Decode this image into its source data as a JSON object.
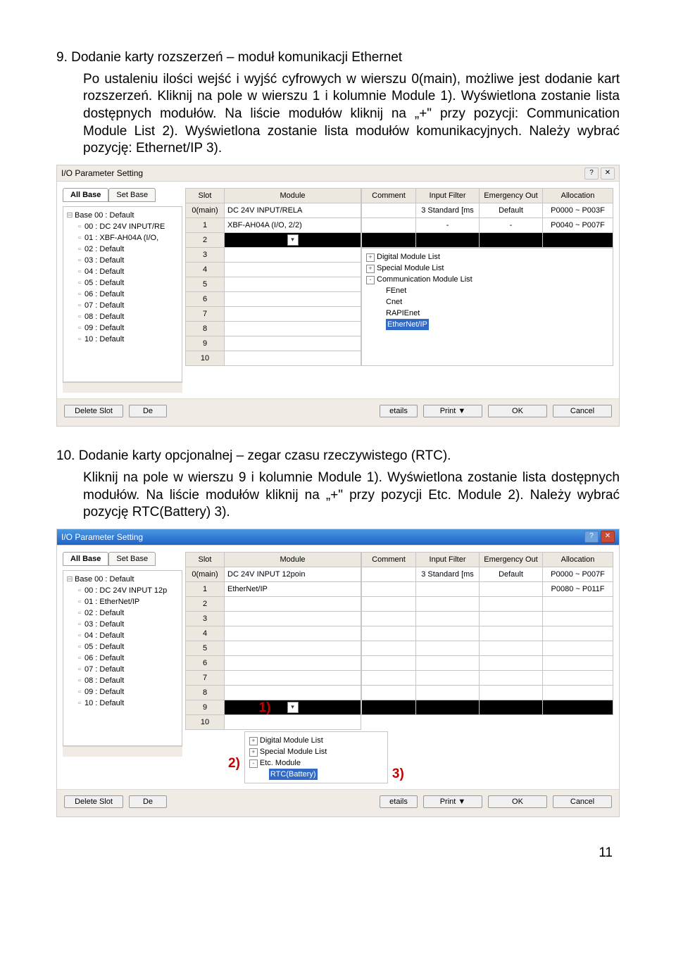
{
  "sec9": {
    "num": "9.",
    "title": "Dodanie karty rozszerzeń – moduł komunikacji Ethernet",
    "p1": "Po ustaleniu ilości wejść i wyjść cyfrowych w wierszu 0(main), możliwe jest dodanie kart rozszerzeń. Kliknij na pole w wierszu 1 i kolumnie Module 1). Wyświetlona zostanie lista dostępnych modułów. Na liście modułów kliknij na „+\" przy pozycji: Communication Module List 2). Wyświetlona zostanie lista modułów komunikacyjnych. Należy wybrać pozycję: Ethernet/IP 3)."
  },
  "sec10": {
    "num": "10.",
    "title": "Dodanie karty opcjonalnej – zegar czasu rzeczywistego (RTC).",
    "p1": "Kliknij na pole w wierszu 9 i kolumnie Module 1). Wyświetlona zostanie lista dostępnych modułów. Na liście modułów kliknij na „+\" przy pozycji Etc. Module 2). Należy wybrać pozycję RTC(Battery) 3)."
  },
  "dlg1": {
    "title": "I/O Parameter Setting",
    "tabs": {
      "all": "All Base",
      "set": "Set Base"
    },
    "tree": {
      "root": "Base 00 : Default",
      "items": [
        "00 : DC 24V INPUT/RE",
        "01 : XBF-AH04A (I/O,",
        "02 : Default",
        "03 : Default",
        "04 : Default",
        "05 : Default",
        "06 : Default",
        "07 : Default",
        "08 : Default",
        "09 : Default",
        "10 : Default"
      ]
    },
    "headers": [
      "Slot",
      "Module",
      "Comment",
      "Input Filter",
      "Emergency Out",
      "Allocation"
    ],
    "rows": [
      {
        "slot": "0(main)",
        "module": "DC 24V INPUT/RELA",
        "comment": "",
        "filter": "3 Standard [ms",
        "emg": "Default",
        "alloc": "P0000 ~ P003F"
      },
      {
        "slot": "1",
        "module": "XBF-AH04A (I/O, 2/2)",
        "comment": "",
        "filter": "-",
        "emg": "-",
        "alloc": "P0040 ~ P007F"
      }
    ],
    "slots_rest": [
      "2",
      "3",
      "4",
      "5",
      "6",
      "7",
      "8",
      "9",
      "10"
    ],
    "mtree": {
      "items": [
        {
          "pm": "+",
          "label": "Digital Module List"
        },
        {
          "pm": "+",
          "label": "Special Module List"
        },
        {
          "pm": "-",
          "label": "Communication Module List"
        },
        {
          "pm": "",
          "label": "FEnet",
          "indent": true
        },
        {
          "pm": "",
          "label": "Cnet",
          "indent": true
        },
        {
          "pm": "",
          "label": "RAPIEnet",
          "indent": true
        },
        {
          "pm": "",
          "label": "EtherNet/IP",
          "indent": true,
          "sel": true
        }
      ]
    },
    "foot": {
      "del": "Delete Slot",
      "de": "De",
      "etails": "etails",
      "print": "Print  ▼",
      "ok": "OK",
      "cancel": "Cancel"
    }
  },
  "dlg2": {
    "title": "I/O Parameter Setting",
    "tabs": {
      "all": "All Base",
      "set": "Set Base"
    },
    "tree": {
      "root": "Base 00 : Default",
      "items": [
        "00 : DC 24V INPUT 12p",
        "01 : EtherNet/IP",
        "02 : Default",
        "03 : Default",
        "04 : Default",
        "05 : Default",
        "06 : Default",
        "07 : Default",
        "08 : Default",
        "09 : Default",
        "10 : Default"
      ]
    },
    "headers": [
      "Slot",
      "Module",
      "Comment",
      "Input Filter",
      "Emergency Out",
      "Allocation"
    ],
    "rows": [
      {
        "slot": "0(main)",
        "module": "DC 24V INPUT 12poin",
        "comment": "",
        "filter": "3 Standard [ms",
        "emg": "Default",
        "alloc": "P0000 ~ P007F"
      },
      {
        "slot": "1",
        "module": "EtherNet/IP",
        "comment": "",
        "filter": "",
        "emg": "",
        "alloc": "P0080 ~ P011F"
      }
    ],
    "slots_rest": [
      "2",
      "3",
      "4",
      "5",
      "6",
      "7",
      "8",
      "9",
      "10"
    ],
    "mtree": {
      "items": [
        {
          "pm": "+",
          "label": "Digital Module List"
        },
        {
          "pm": "+",
          "label": "Special Module List"
        },
        {
          "pm": "-",
          "label": "Etc. Module"
        },
        {
          "pm": "",
          "label": "RTC(Battery)",
          "indent": true,
          "sel": true
        }
      ]
    },
    "marks": {
      "m1": "1)",
      "m2": "2)",
      "m3": "3)"
    },
    "foot": {
      "del": "Delete Slot",
      "de": "De",
      "etails": "etails",
      "print": "Print  ▼",
      "ok": "OK",
      "cancel": "Cancel"
    }
  },
  "page_num": "11"
}
